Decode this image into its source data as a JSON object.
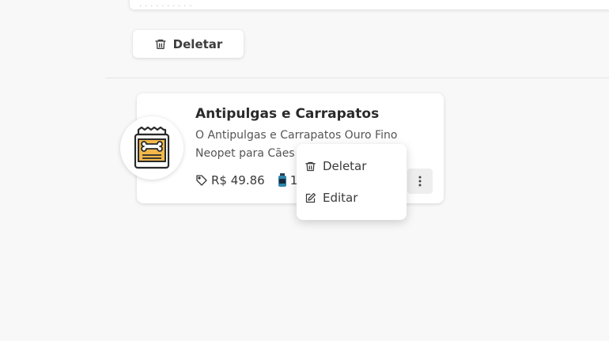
{
  "toolbar": {
    "delete_label": "Deletar"
  },
  "product": {
    "name": "Antipulgas e Carrapatos",
    "description": "O Antipulgas e Carrapatos Ouro Fino Neopet para Cães ... é u...",
    "price": "R$ 49.86",
    "stock_partial": "1,3",
    "icon": "pet-food-jar-icon"
  },
  "context_menu": {
    "delete_label": "Deletar",
    "edit_label": "Editar"
  },
  "colors": {
    "background": "#f8f8f8",
    "card": "#ffffff",
    "jar_accent": "#f2b84b"
  }
}
